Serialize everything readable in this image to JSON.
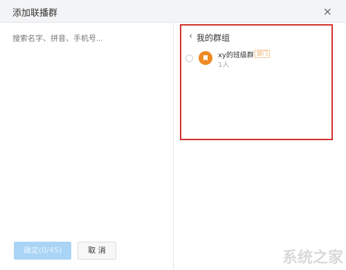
{
  "dialog": {
    "title": "添加联播群",
    "close_glyph": "×"
  },
  "search": {
    "placeholder": "搜索名字、拼音、手机号..."
  },
  "buttons": {
    "confirm_label": "确定(0/45)",
    "cancel_label": "取 消"
  },
  "group_panel": {
    "back_glyph": "‹",
    "title": "我的群组",
    "items": [
      {
        "name": "xy的班级群",
        "badge": "部门",
        "members": "1人",
        "avatar_color": "#f08a24"
      }
    ]
  },
  "colors": {
    "highlight_border": "#d0302c",
    "confirm_bg": "#a9d4f5",
    "badge": "#f0a35a"
  },
  "watermark": {
    "text": "系统之家"
  }
}
